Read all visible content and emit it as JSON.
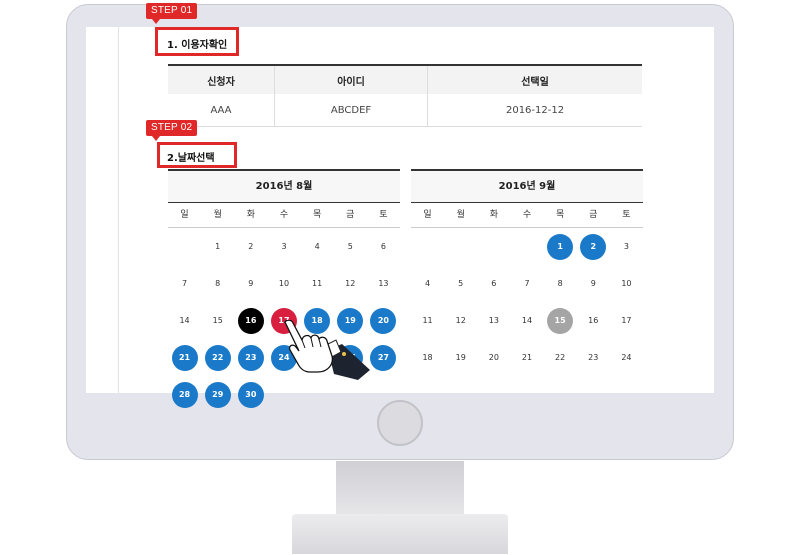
{
  "step1": {
    "tag": "STEP 01",
    "title": "1. 이용자확인"
  },
  "step2": {
    "tag": "STEP 02",
    "title": "2.날짜선택"
  },
  "user_table": {
    "headers": [
      "신청자",
      "아이디",
      "선택일"
    ],
    "row": [
      "AAA",
      "ABCDEF",
      "2016-12-12"
    ]
  },
  "weekdays": [
    "일",
    "월",
    "화",
    "수",
    "목",
    "금",
    "토"
  ],
  "calendars": [
    {
      "title": "2016년 8월",
      "weeks": [
        [
          {
            "d": ""
          },
          {
            "d": "1"
          },
          {
            "d": "2"
          },
          {
            "d": "3"
          },
          {
            "d": "4"
          },
          {
            "d": "5"
          },
          {
            "d": "6"
          }
        ],
        [
          {
            "d": "7"
          },
          {
            "d": "8"
          },
          {
            "d": "9"
          },
          {
            "d": "10"
          },
          {
            "d": "11"
          },
          {
            "d": "12"
          },
          {
            "d": "13"
          }
        ],
        [
          {
            "d": "14"
          },
          {
            "d": "15"
          },
          {
            "d": "16",
            "s": "black"
          },
          {
            "d": "17",
            "s": "red"
          },
          {
            "d": "18",
            "s": "blue"
          },
          {
            "d": "19",
            "s": "blue"
          },
          {
            "d": "20",
            "s": "blue"
          }
        ],
        [
          {
            "d": "21",
            "s": "blue"
          },
          {
            "d": "22",
            "s": "blue"
          },
          {
            "d": "23",
            "s": "blue"
          },
          {
            "d": "24",
            "s": "blue"
          },
          {
            "d": "25",
            "s": "blue"
          },
          {
            "d": "26",
            "s": "blue"
          },
          {
            "d": "27",
            "s": "blue"
          }
        ],
        [
          {
            "d": "28",
            "s": "blue"
          },
          {
            "d": "29",
            "s": "blue"
          },
          {
            "d": "30",
            "s": "blue"
          },
          {
            "d": ""
          },
          {
            "d": ""
          },
          {
            "d": ""
          },
          {
            "d": ""
          }
        ]
      ]
    },
    {
      "title": "2016년 9월",
      "weeks": [
        [
          {
            "d": ""
          },
          {
            "d": ""
          },
          {
            "d": ""
          },
          {
            "d": ""
          },
          {
            "d": "1",
            "s": "blue"
          },
          {
            "d": "2",
            "s": "blue"
          },
          {
            "d": "3"
          }
        ],
        [
          {
            "d": "4"
          },
          {
            "d": "5"
          },
          {
            "d": "6"
          },
          {
            "d": "7"
          },
          {
            "d": "8"
          },
          {
            "d": "9"
          },
          {
            "d": "10"
          }
        ],
        [
          {
            "d": "11"
          },
          {
            "d": "12"
          },
          {
            "d": "13"
          },
          {
            "d": "14"
          },
          {
            "d": "15",
            "s": "gray"
          },
          {
            "d": "16"
          },
          {
            "d": "17"
          }
        ],
        [
          {
            "d": "18"
          },
          {
            "d": "19"
          },
          {
            "d": "20"
          },
          {
            "d": "21"
          },
          {
            "d": "22"
          },
          {
            "d": "23"
          },
          {
            "d": "24"
          }
        ]
      ]
    }
  ],
  "colors": {
    "accent_red": "#e02828",
    "selected_blue": "#1a7ac9",
    "today_black": "#000000",
    "picked_red": "#d81f3f",
    "disabled_gray": "#a5a5a5"
  },
  "icons": {
    "cursor": "pointing-hand-icon",
    "camera": "webcam-icon"
  }
}
